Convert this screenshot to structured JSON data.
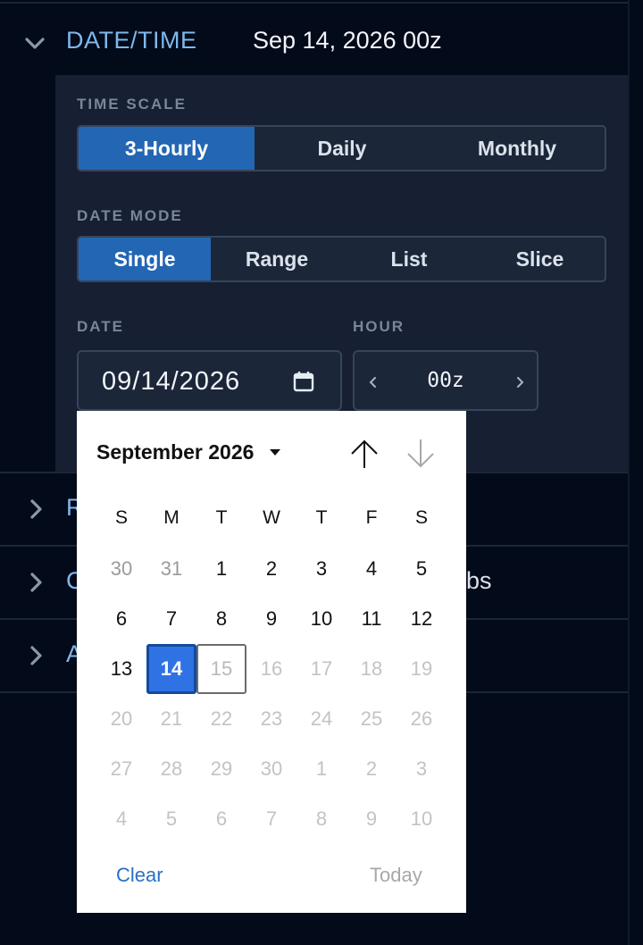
{
  "section": {
    "title": "DATE/TIME",
    "value": "Sep 14, 2026 00z"
  },
  "time_scale": {
    "label": "TIME SCALE",
    "options": [
      "3-Hourly",
      "Daily",
      "Monthly"
    ],
    "selected": "3-Hourly"
  },
  "date_mode": {
    "label": "DATE MODE",
    "options": [
      "Single",
      "Range",
      "List",
      "Slice"
    ],
    "selected": "Single"
  },
  "date_field": {
    "label": "DATE",
    "value": "09/14/2026",
    "icon": "calendar-icon"
  },
  "hour_field": {
    "label": "HOUR",
    "value": "00z",
    "prev_icon": "chevron-left-icon",
    "next_icon": "chevron-right-icon"
  },
  "collapsed_rows": [
    {
      "letter": "R",
      "tail": ""
    },
    {
      "letter": "C",
      "tail": "bs"
    },
    {
      "letter": "A",
      "tail": ""
    }
  ],
  "calendar": {
    "month_label": "September 2026",
    "weekdays": [
      "S",
      "M",
      "T",
      "W",
      "T",
      "F",
      "S"
    ],
    "weeks": [
      [
        {
          "d": "30",
          "s": "muted"
        },
        {
          "d": "31",
          "s": "muted"
        },
        {
          "d": "1",
          "s": "normal"
        },
        {
          "d": "2",
          "s": "normal"
        },
        {
          "d": "3",
          "s": "normal"
        },
        {
          "d": "4",
          "s": "normal"
        },
        {
          "d": "5",
          "s": "normal"
        }
      ],
      [
        {
          "d": "6",
          "s": "normal"
        },
        {
          "d": "7",
          "s": "normal"
        },
        {
          "d": "8",
          "s": "normal"
        },
        {
          "d": "9",
          "s": "normal"
        },
        {
          "d": "10",
          "s": "normal"
        },
        {
          "d": "11",
          "s": "normal"
        },
        {
          "d": "12",
          "s": "normal"
        }
      ],
      [
        {
          "d": "13",
          "s": "normal"
        },
        {
          "d": "14",
          "s": "selected"
        },
        {
          "d": "15",
          "s": "next"
        },
        {
          "d": "16",
          "s": "disabled"
        },
        {
          "d": "17",
          "s": "disabled"
        },
        {
          "d": "18",
          "s": "disabled"
        },
        {
          "d": "19",
          "s": "disabled"
        }
      ],
      [
        {
          "d": "20",
          "s": "disabled"
        },
        {
          "d": "21",
          "s": "disabled"
        },
        {
          "d": "22",
          "s": "disabled"
        },
        {
          "d": "23",
          "s": "disabled"
        },
        {
          "d": "24",
          "s": "disabled"
        },
        {
          "d": "25",
          "s": "disabled"
        },
        {
          "d": "26",
          "s": "disabled"
        }
      ],
      [
        {
          "d": "27",
          "s": "disabled"
        },
        {
          "d": "28",
          "s": "disabled"
        },
        {
          "d": "29",
          "s": "disabled"
        },
        {
          "d": "30",
          "s": "disabled"
        },
        {
          "d": "1",
          "s": "disabled"
        },
        {
          "d": "2",
          "s": "disabled"
        },
        {
          "d": "3",
          "s": "disabled"
        }
      ],
      [
        {
          "d": "4",
          "s": "disabled"
        },
        {
          "d": "5",
          "s": "disabled"
        },
        {
          "d": "6",
          "s": "disabled"
        },
        {
          "d": "7",
          "s": "disabled"
        },
        {
          "d": "8",
          "s": "disabled"
        },
        {
          "d": "9",
          "s": "disabled"
        },
        {
          "d": "10",
          "s": "disabled"
        }
      ]
    ],
    "clear_label": "Clear",
    "today_label": "Today",
    "icons": {
      "caret": "caret-down-icon",
      "up": "arrow-up-icon",
      "down": "arrow-down-icon"
    }
  },
  "colors": {
    "accent": "#2366b3",
    "link": "#7fb8ec",
    "selected_day": "#2f72e4"
  }
}
